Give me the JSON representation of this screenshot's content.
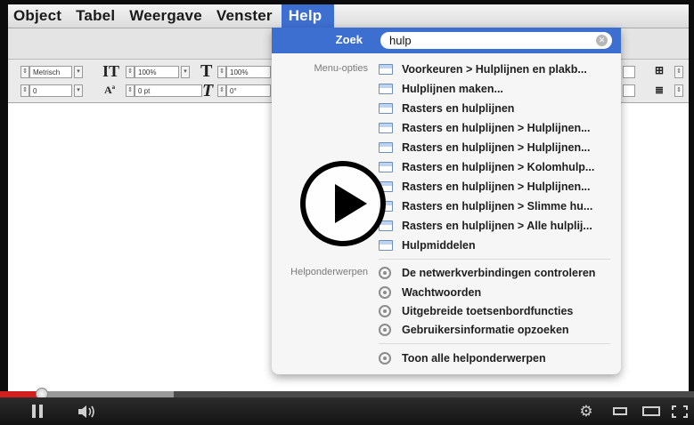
{
  "menubar": {
    "items": [
      "Object",
      "Tabel",
      "Weergave",
      "Venster",
      "Help"
    ]
  },
  "toolbar": {
    "font_field": "Metrisch",
    "size_top": "100%",
    "size_top_right": "100%",
    "leading_field": "0",
    "baseline_field": "0 pt",
    "skew_field": "0°"
  },
  "help_menu": {
    "search_label": "Zoek",
    "search_value": "hulp",
    "menu_section_label": "Menu-opties",
    "menu_options": [
      "Voorkeuren > Hulplijnen en plakb...",
      "Hulplijnen maken...",
      "Rasters en hulplijnen",
      "Rasters en hulplijnen > Hulplijnen...",
      "Rasters en hulplijnen > Hulplijnen...",
      "Rasters en hulplijnen > Kolomhulp...",
      "Rasters en hulplijnen > Hulplijnen...",
      "Rasters en hulplijnen > Slimme hu...",
      "Rasters en hulplijnen > Alle hulplij...",
      "Hulpmiddelen"
    ],
    "topics_section_label": "Helponderwerpen",
    "topics": [
      "De netwerkverbindingen controleren",
      "Wachtwoorden",
      "Uitgebreide toetsenbordfuncties",
      "Gebruikersinformatie opzoeken"
    ],
    "show_all": "Toon alle helponderwerpen"
  },
  "video": {
    "played_fraction": 0.06,
    "buffered_fraction": 0.25,
    "accent_color": "#d41f1f"
  }
}
